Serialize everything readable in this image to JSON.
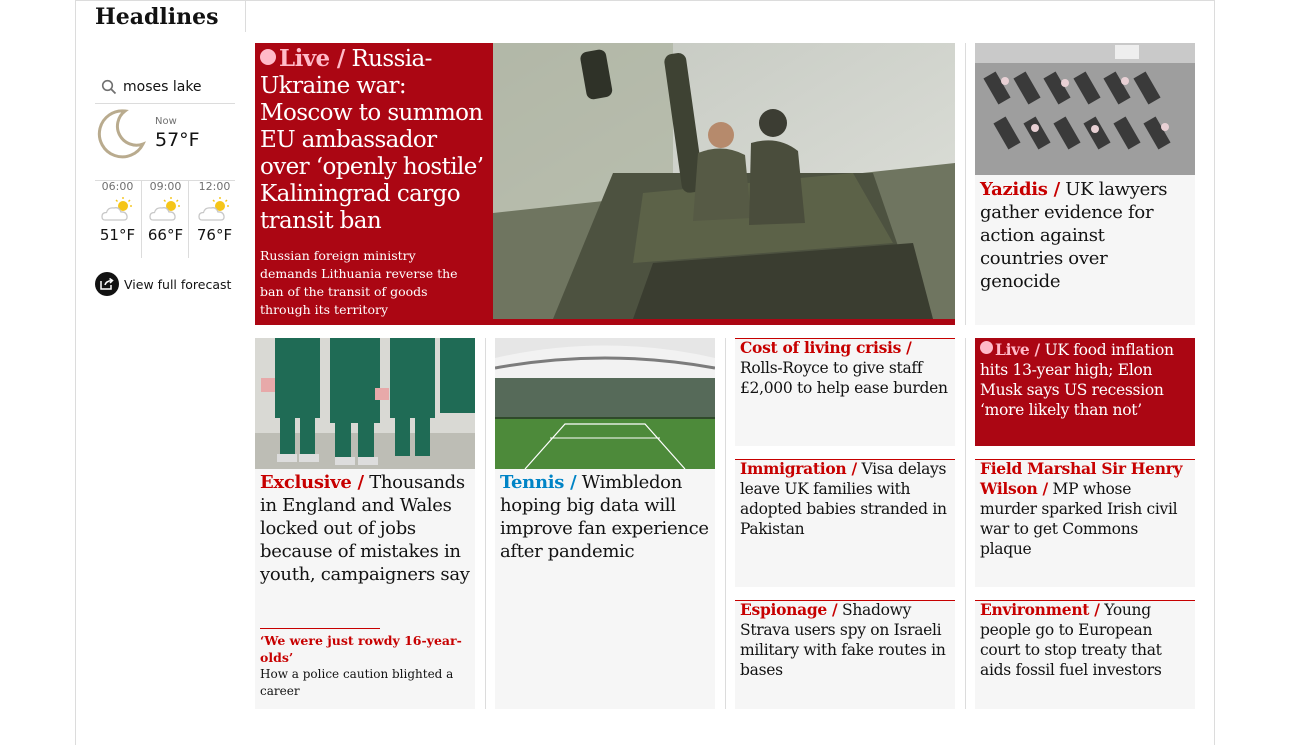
{
  "section": {
    "title": "Headlines"
  },
  "weather": {
    "location": "moses lake",
    "now_label": "Now",
    "now_temp": "57°F",
    "forecast": [
      {
        "time": "06:00",
        "temp": "51°F",
        "icon": "partly-cloudy-icon"
      },
      {
        "time": "09:00",
        "temp": "66°F",
        "icon": "partly-cloudy-icon"
      },
      {
        "time": "12:00",
        "temp": "76°F",
        "icon": "partly-cloudy-icon"
      }
    ],
    "full_forecast_label": "View full forecast"
  },
  "feature": {
    "live_label": "Live /",
    "headline": "Russia-Ukraine war: Moscow to summon EU ambassador over ‘openly hostile’ Kaliningrad cargo transit ban",
    "standfirst": "Russian foreign ministry demands Lithuania reverse the ban of the transit of goods through its territory"
  },
  "cards": {
    "yazidis": {
      "kicker": "Yazidis /",
      "headline": "UK lawyers gather evidence for action against countries over genocide"
    },
    "exclusive": {
      "kicker": "Exclusive /",
      "headline": "Thousands in England and Wales locked out of jobs because of mistakes in youth, campaigners say",
      "sublink_kicker": "‘We were just rowdy 16-year-olds’",
      "sublink_text": "How a police caution blighted a career"
    },
    "tennis": {
      "kicker": "Tennis /",
      "headline": "Wimbledon hoping big data will improve fan experience after pandemic"
    },
    "cost_of_living": {
      "kicker": "Cost of living crisis /",
      "headline": "Rolls-Royce to give staff £2,000 to help ease burden"
    },
    "food_inflation": {
      "live_label": "Live /",
      "headline": "UK food inflation hits 13-year high; Elon Musk says US recession ‘more likely than not’"
    },
    "immigration": {
      "kicker": "Immigration  /",
      "headline": "Visa delays leave UK families with adopted babies stranded in Pakistan"
    },
    "wilson": {
      "kicker": "Field Marshal Sir Henry Wilson /",
      "headline": "MP whose murder sparked Irish civil war to get Commons plaque"
    },
    "espionage": {
      "kicker": "Espionage /",
      "headline": "Shadowy Strava users spy on Israeli military with fake routes in bases"
    },
    "environment": {
      "kicker": "Environment /",
      "headline": "Young people go to European court to stop treaty that aids fossil fuel investors"
    }
  },
  "colors": {
    "news_red": "#c70000",
    "live_bg": "#ab0613",
    "live_pink": "#ffbac8",
    "sport_blue": "#0084c6",
    "card_bg": "#f6f6f6"
  }
}
